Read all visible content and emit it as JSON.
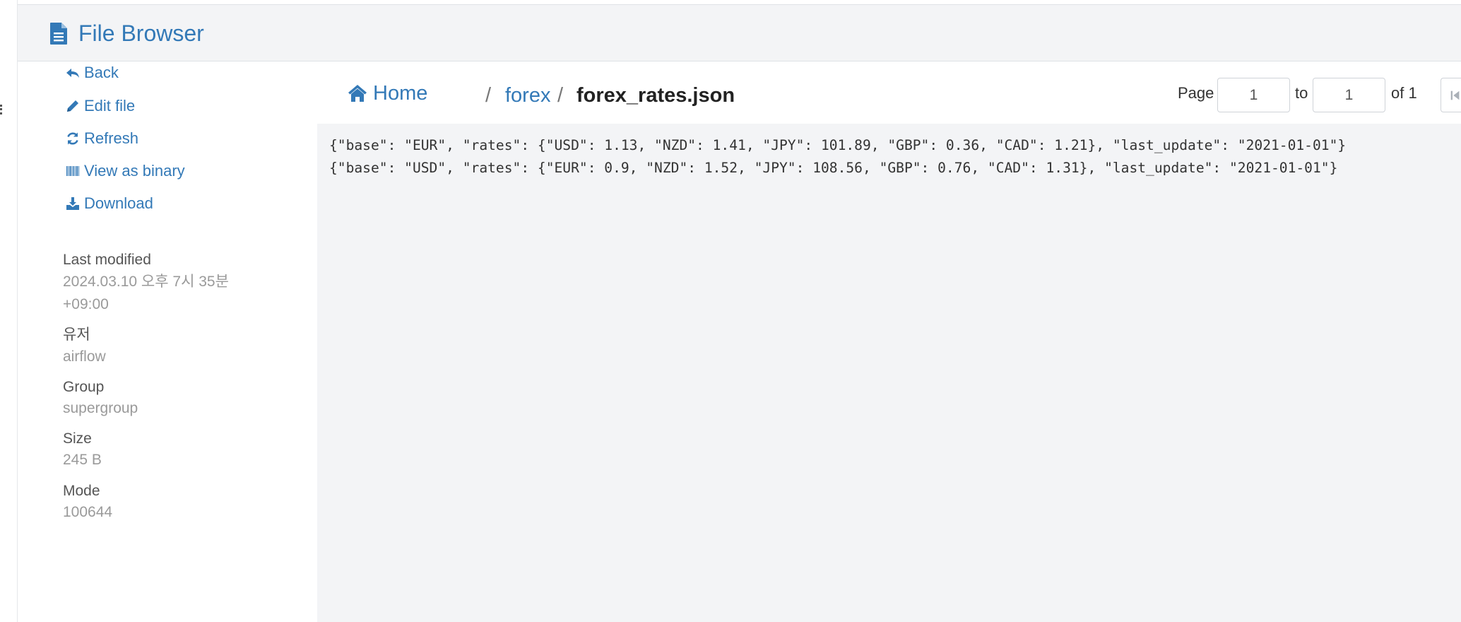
{
  "header": {
    "title": "File Browser"
  },
  "sidebar": {
    "actions": [
      {
        "label": "Back",
        "icon": "reply-icon"
      },
      {
        "label": "Edit file",
        "icon": "pencil-icon"
      },
      {
        "label": "Refresh",
        "icon": "refresh-icon"
      },
      {
        "label": "View as binary",
        "icon": "barcode-icon"
      },
      {
        "label": "Download",
        "icon": "download-icon"
      }
    ],
    "meta": {
      "last_modified_label": "Last modified",
      "last_modified_value_line1": "2024.03.10 오후 7시 35분",
      "last_modified_value_line2": "+09:00",
      "user_label": "유저",
      "user_value": "airflow",
      "group_label": "Group",
      "group_value": "supergroup",
      "size_label": "Size",
      "size_value": "245 B",
      "mode_label": "Mode",
      "mode_value": "100644"
    }
  },
  "breadcrumb": {
    "home": "Home",
    "separator": "/",
    "folder": "forex",
    "file": "forex_rates.json"
  },
  "pager": {
    "page_label": "Page",
    "from_value": "1",
    "to_label": "to",
    "to_value": "1",
    "of_label": "of 1"
  },
  "content": {
    "lines": [
      "{\"base\": \"EUR\", \"rates\": {\"USD\": 1.13, \"NZD\": 1.41, \"JPY\": 101.89, \"GBP\": 0.36, \"CAD\": 1.21}, \"last_update\": \"2021-01-01\"}",
      "{\"base\": \"USD\", \"rates\": {\"EUR\": 0.9, \"NZD\": 1.52, \"JPY\": 108.56, \"GBP\": 0.76, \"CAD\": 1.31}, \"last_update\": \"2021-01-01\"}"
    ]
  },
  "colors": {
    "accent": "#3379b7",
    "header_bg": "#f3f4f6",
    "content_bg": "#f3f4f6",
    "muted_text": "#9a9a9a"
  }
}
